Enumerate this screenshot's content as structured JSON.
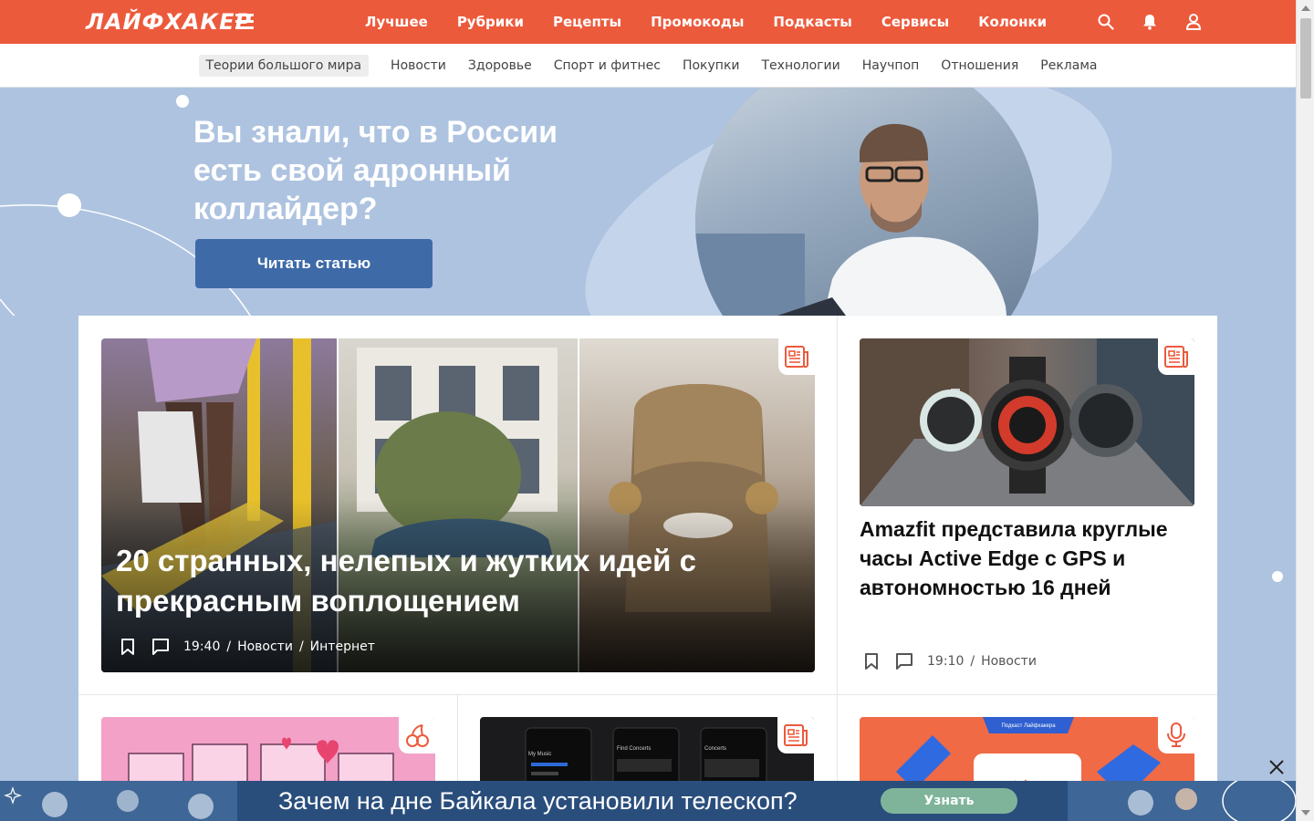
{
  "header": {
    "logo": "ЛАЙФХАКЕР",
    "nav": [
      "Лучшее",
      "Рубрики",
      "Рецепты",
      "Промокоды",
      "Подкасты",
      "Сервисы",
      "Колонки"
    ],
    "icons": [
      "search-icon",
      "bell-icon",
      "user-icon"
    ],
    "brand_color": "#ec5a3c"
  },
  "subnav": {
    "items": [
      "Теории большого мира",
      "Новости",
      "Здоровье",
      "Спорт и фитнес",
      "Покупки",
      "Технологии",
      "Научпоп",
      "Отношения",
      "Реклама"
    ],
    "active": "Теории большого мира"
  },
  "hero": {
    "title": "Вы знали, что в России есть свой адронный коллайдер?",
    "button": "Читать статью",
    "bg_color": "#aec3e0"
  },
  "featured": {
    "title": "20 странных, нелепых и жутких идей с прекрасным воплощением",
    "time": "19:40",
    "category": "Новости",
    "tag": "Интернет",
    "badge_icon": "article-icon"
  },
  "side_article": {
    "title": "Amazfit представила круглые часы Active Edge с GPS и автономностью 16 дней",
    "time": "19:10",
    "category": "Новости",
    "badge_icon": "article-icon"
  },
  "thumbs": [
    {
      "badge_icon": "cherry-icon"
    },
    {
      "badge_icon": "article-icon",
      "mock_labels": [
        "My Music",
        "Find Concerts",
        "Concerts"
      ]
    },
    {
      "badge_icon": "microphone-icon",
      "label": "Подкаст Лайфхакера"
    }
  ],
  "banner": {
    "text": "Зачем на дне Байкала установили телескоп?",
    "button": "Узнать"
  }
}
